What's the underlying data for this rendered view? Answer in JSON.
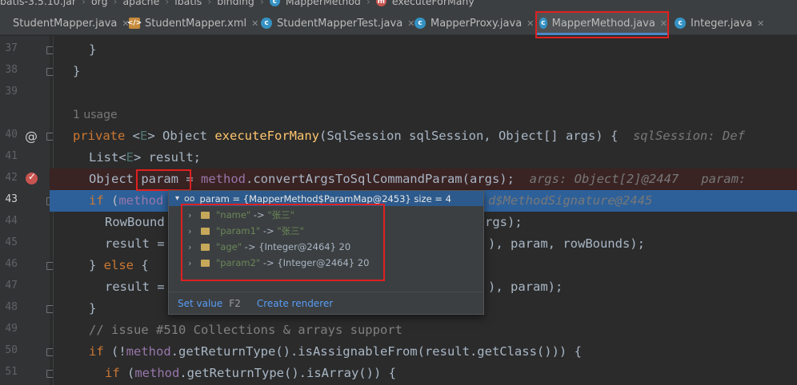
{
  "breadcrumb": {
    "items": [
      "batis-3.5.10.jar",
      "org",
      "apache",
      "ibatis",
      "binding",
      "MapperMethod",
      "executeForMany"
    ]
  },
  "tabs": [
    {
      "label": "StudentMapper.java",
      "icon": "interface-icon"
    },
    {
      "label": "StudentMapper.xml",
      "icon": "xml-icon"
    },
    {
      "label": "StudentMapperTest.java",
      "icon": "class-icon"
    },
    {
      "label": "MapperProxy.java",
      "icon": "class-icon"
    },
    {
      "label": "MapperMethod.java",
      "icon": "class-icon",
      "active": true
    },
    {
      "label": "Integer.java",
      "icon": "class-icon"
    }
  ],
  "gutter": {
    "line_numbers": [
      "37",
      "38",
      "39",
      "40",
      "41",
      "42",
      "43",
      "44",
      "45",
      "46",
      "47",
      "48",
      "49",
      "50",
      "51"
    ],
    "at_marker": "@"
  },
  "code": {
    "usage_hint": "1 usage",
    "lines": {
      "l37": "}",
      "l38": "}",
      "l40_kw": "private",
      "l40_a": " <",
      "l40_tp": "E",
      "l40_b": "> Object ",
      "l40_fn": "executeForMany",
      "l40_c": "(SqlSession sqlSession, Object[] args) {",
      "l40_hint": "  sqlSession: Def",
      "l41_a": "List<",
      "l41_tp": "E",
      "l41_b": "> result;",
      "l42_a": "Object ",
      "l42_param": "param",
      "l42_b": " = ",
      "l42_fld": "method",
      "l42_c": ".convertArgsToSqlCommandParam(args);",
      "l42_hint": "  args: Object[2]@2447   param:",
      "l43_kw": "if",
      "l43_a": " (",
      "l43_fld": "method",
      "l43_hint": "d$MethodSignature@2445",
      "l44_a": "RowBound",
      "l44_b": "rgs);",
      "l45_a": "result =",
      "l45_b": "), param, rowBounds);",
      "l46_a": "} ",
      "l46_kw": "else",
      "l46_b": " {",
      "l47_a": "result =",
      "l47_b": "), param);",
      "l48": "}",
      "l49": "// issue #510 Collections & arrays support",
      "l50_kw": "if",
      "l50_a": " (!",
      "l50_fld": "method",
      "l50_b": ".getReturnType().isAssignableFrom(result.getClass())) {",
      "l51_kw": "if",
      "l51_a": " (",
      "l51_fld": "method",
      "l51_b": ".getReturnType().isArray()) {"
    }
  },
  "debug_popup": {
    "header": "param = {MapperMethod$ParamMap@2453}  size = 4",
    "entries": [
      {
        "key": "\"name\"",
        "arrow": "->",
        "value": "\"张三\"",
        "kind": "string"
      },
      {
        "key": "\"param1\"",
        "arrow": "->",
        "value": "\"张三\"",
        "kind": "string"
      },
      {
        "key": "\"age\"",
        "arrow": "->",
        "value": "{Integer@2464} 20",
        "kind": "object"
      },
      {
        "key": "\"param2\"",
        "arrow": "->",
        "value": "{Integer@2464} 20",
        "kind": "object"
      }
    ],
    "footer": {
      "set_value": "Set value",
      "set_value_key": "F2",
      "create_renderer": "Create renderer"
    }
  },
  "colors": {
    "editor_bg": "#2b2b2b",
    "keyword": "#cc7832",
    "method_name": "#ffc66d",
    "field": "#9876aa",
    "comment": "#808080",
    "string": "#6a8759",
    "execution_line": "#2d6099",
    "annotation_box": "#e02020"
  }
}
